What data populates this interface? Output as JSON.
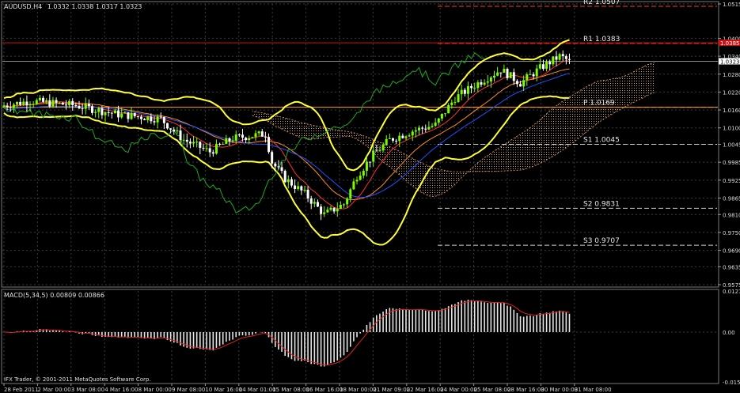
{
  "chart_data": [
    {
      "type": "candlestick",
      "title": "AUDUSD,H4",
      "ohlc": "1.0332 1.0338 1.0317 1.0323",
      "y_ticks": [
        "1.0515",
        "1.0400",
        "1.0340",
        "1.0280",
        "1.0220",
        "1.0160",
        "1.0100",
        "1.0045",
        "0.9985",
        "0.9925",
        "0.9865",
        "0.9810",
        "0.9750",
        "0.9690",
        "0.9635",
        "0.9575"
      ],
      "ylim": [
        0.9575,
        1.0515
      ],
      "current_price": "1.0323",
      "alert_price": "1.0385",
      "pivot_levels": [
        {
          "name": "R2",
          "label": "R2  1.0507",
          "value": 1.0507,
          "color": "#ff3b1f"
        },
        {
          "name": "R1",
          "label": "R1  1.0383",
          "value": 1.0383,
          "color": "#ff3b1f"
        },
        {
          "name": "P",
          "label": "P  1.0169",
          "value": 1.0169,
          "color": "#ff9f1a"
        },
        {
          "name": "S1",
          "label": "S1  1.0045",
          "value": 1.0045,
          "color": "#cfcfcf"
        },
        {
          "name": "S2",
          "label": "S2  0.9831",
          "value": 0.9831,
          "color": "#cfcfcf"
        },
        {
          "name": "S3",
          "label": "S3  0.9707",
          "value": 0.9707,
          "color": "#cfcfcf"
        }
      ],
      "x_ticks": [
        "28 Feb 2011",
        "2 Mar 00:00",
        "3 Mar 08:00",
        "4 Mar 16:00",
        "8 Mar 00:00",
        "9 Mar 08:00",
        "10 Mar 16:00",
        "14 Mar 01:00",
        "15 Mar 08:00",
        "16 Mar 16:00",
        "18 Mar 00:00",
        "21 Mar 09:00",
        "22 Mar 16:00",
        "24 Mar 00:00",
        "25 Mar 08:00",
        "28 Mar 16:00",
        "30 Mar 00:00",
        "31 Mar 08:00"
      ],
      "colors": {
        "up": "#7CFC00",
        "down": "#ffffff",
        "bands": "#ffff33",
        "tenkan": "#ff3030",
        "kijun": "#2050ff",
        "chikou": "#1fa81f",
        "cloud": "#d2a06a",
        "ma": "#ff8c1a"
      }
    },
    {
      "type": "bar",
      "title": "MACD(5,34,5) 0.00809 0.00866",
      "y_ticks": [
        "0.01275",
        "0.00",
        "-0.01546"
      ],
      "ylim": [
        -0.01546,
        0.01275
      ],
      "colors": {
        "histogram": "#e6e6e6",
        "signal": "#e02020"
      }
    }
  ],
  "footer": "IFX Trader, © 2001-2011 MetaQuotes Software Corp."
}
